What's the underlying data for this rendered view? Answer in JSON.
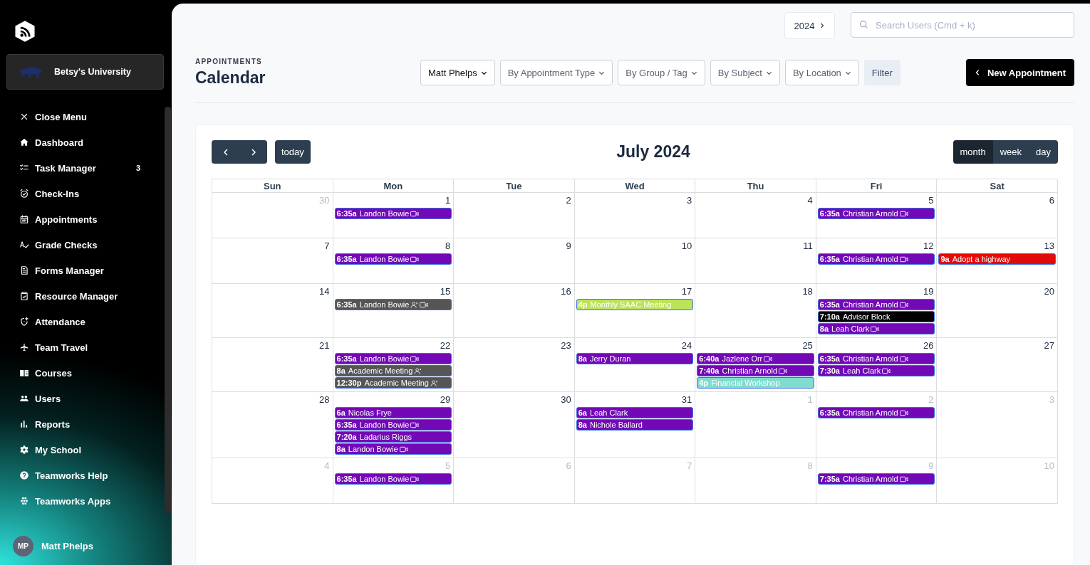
{
  "sidebar": {
    "university": "Betsy's University",
    "items": [
      {
        "label": "Close Menu"
      },
      {
        "label": "Dashboard"
      },
      {
        "label": "Task Manager",
        "badge": "3"
      },
      {
        "label": "Check-Ins"
      },
      {
        "label": "Appointments"
      },
      {
        "label": "Grade Checks"
      },
      {
        "label": "Forms Manager"
      },
      {
        "label": "Resource Manager"
      },
      {
        "label": "Attendance"
      },
      {
        "label": "Team Travel"
      },
      {
        "label": "Courses"
      },
      {
        "label": "Users"
      },
      {
        "label": "Reports"
      },
      {
        "label": "My School"
      },
      {
        "label": "Teamworks Help"
      },
      {
        "label": "Teamworks Apps"
      }
    ],
    "user": {
      "initials": "MP",
      "name": "Matt Phelps"
    }
  },
  "header": {
    "year": "2024",
    "search": {
      "placeholder": "Search Users (Cmd + k)"
    }
  },
  "page": {
    "eyebrow": "APPOINTMENTS",
    "title": "Calendar"
  },
  "filters": [
    {
      "label": "Matt Phelps",
      "set": true
    },
    {
      "label": "By Appointment Type",
      "set": false
    },
    {
      "label": "By Group / Tag",
      "set": false
    },
    {
      "label": "By Subject",
      "set": false
    },
    {
      "label": "By Location",
      "set": false
    }
  ],
  "filter_button": "Filter",
  "new_button": "New Appointment",
  "calendar": {
    "title": "July 2024",
    "today": "today",
    "views": [
      {
        "label": "month",
        "selected": true
      },
      {
        "label": "week",
        "selected": false
      },
      {
        "label": "day",
        "selected": false
      }
    ],
    "weekdays": [
      "Sun",
      "Mon",
      "Tue",
      "Wed",
      "Thu",
      "Fri",
      "Sat"
    ],
    "weeks": [
      {
        "days": [
          {
            "date": "30",
            "other_month": true
          },
          {
            "date": "1",
            "other_month": false,
            "events": [
              {
                "time": "6:35a",
                "title": "Landon Bowie",
                "color": "#7209b7",
                "invite": false,
                "video": true
              }
            ]
          },
          {
            "date": "2",
            "other_month": false
          },
          {
            "date": "3",
            "other_month": false
          },
          {
            "date": "4",
            "other_month": false
          },
          {
            "date": "5",
            "other_month": false,
            "events": [
              {
                "time": "6:35a",
                "title": "Christian Arnold",
                "color": "#7209b7",
                "invite": false,
                "video": true
              }
            ]
          },
          {
            "date": "6",
            "other_month": false
          }
        ]
      },
      {
        "days": [
          {
            "date": "7",
            "other_month": false
          },
          {
            "date": "8",
            "other_month": false,
            "events": [
              {
                "time": "6:35a",
                "title": "Landon Bowie",
                "color": "#7209b7",
                "invite": false,
                "video": true
              }
            ]
          },
          {
            "date": "9",
            "other_month": false
          },
          {
            "date": "10",
            "other_month": false
          },
          {
            "date": "11",
            "other_month": false
          },
          {
            "date": "12",
            "other_month": false,
            "events": [
              {
                "time": "6:35a",
                "title": "Christian Arnold",
                "color": "#7209b7",
                "invite": false,
                "video": true
              }
            ]
          },
          {
            "date": "13",
            "other_month": false,
            "events": [
              {
                "time": "9a",
                "title": "Adopt a highway",
                "color": "#e00b0b",
                "invite": false,
                "video": false
              }
            ]
          }
        ]
      },
      {
        "days": [
          {
            "date": "14",
            "other_month": false
          },
          {
            "date": "15",
            "other_month": false,
            "events": [
              {
                "time": "6:35a",
                "title": "Landon Bowie",
                "color": "#555555",
                "invite": true,
                "video": true
              }
            ]
          },
          {
            "date": "16",
            "other_month": false
          },
          {
            "date": "17",
            "other_month": false,
            "events": [
              {
                "time": "4p",
                "title": "Monthly SAAC Meeting",
                "color": "#bde35a",
                "invite": false,
                "video": false
              }
            ]
          },
          {
            "date": "18",
            "other_month": false
          },
          {
            "date": "19",
            "other_month": false,
            "events": [
              {
                "time": "6:35a",
                "title": "Christian Arnold",
                "color": "#7209b7",
                "invite": false,
                "video": true
              },
              {
                "time": "7:10a",
                "title": "Advisor Block",
                "color": "#000000",
                "invite": false,
                "video": false
              },
              {
                "time": "8a",
                "title": "Leah Clark",
                "color": "#7209b7",
                "invite": false,
                "video": true
              }
            ]
          },
          {
            "date": "20",
            "other_month": false
          }
        ]
      },
      {
        "days": [
          {
            "date": "21",
            "other_month": false
          },
          {
            "date": "22",
            "other_month": false,
            "events": [
              {
                "time": "6:35a",
                "title": "Landon Bowie",
                "color": "#7209b7",
                "invite": false,
                "video": true
              },
              {
                "time": "8a",
                "title": "Academic Meeting",
                "color": "#555555",
                "invite": true,
                "video": false
              },
              {
                "time": "12:30p",
                "title": "Academic Meeting",
                "color": "#555555",
                "invite": true,
                "video": false
              }
            ]
          },
          {
            "date": "23",
            "other_month": false
          },
          {
            "date": "24",
            "other_month": false,
            "events": [
              {
                "time": "8a",
                "title": "Jerry Duran",
                "color": "#7209b7",
                "invite": false,
                "video": false
              }
            ]
          },
          {
            "date": "25",
            "other_month": false,
            "events": [
              {
                "time": "6:40a",
                "title": "Jazlene Orr",
                "color": "#7209b7",
                "invite": false,
                "video": true
              },
              {
                "time": "7:40a",
                "title": "Christian Arnold",
                "color": "#7209b7",
                "invite": false,
                "video": true
              },
              {
                "time": "4p",
                "title": "Financial Workshop",
                "color": "#7fdccf",
                "invite": false,
                "video": false
              }
            ]
          },
          {
            "date": "26",
            "other_month": false,
            "events": [
              {
                "time": "6:35a",
                "title": "Christian Arnold",
                "color": "#7209b7",
                "invite": false,
                "video": true
              },
              {
                "time": "7:30a",
                "title": "Leah Clark",
                "color": "#7209b7",
                "invite": false,
                "video": true
              }
            ]
          },
          {
            "date": "27",
            "other_month": false
          }
        ]
      },
      {
        "days": [
          {
            "date": "28",
            "other_month": false
          },
          {
            "date": "29",
            "other_month": false,
            "events": [
              {
                "time": "6a",
                "title": "Nicolas Frye",
                "color": "#7209b7",
                "invite": false,
                "video": false
              },
              {
                "time": "6:35a",
                "title": "Landon Bowie",
                "color": "#7209b7",
                "invite": false,
                "video": true
              },
              {
                "time": "7:20a",
                "title": "Ladarius Riggs",
                "color": "#7209b7",
                "invite": false,
                "video": false
              },
              {
                "time": "8a",
                "title": "Landon Bowie",
                "color": "#7209b7",
                "invite": false,
                "video": true
              }
            ]
          },
          {
            "date": "30",
            "other_month": false
          },
          {
            "date": "31",
            "other_month": false,
            "events": [
              {
                "time": "6a",
                "title": "Leah Clark",
                "color": "#7209b7",
                "invite": false,
                "video": false
              },
              {
                "time": "8a",
                "title": "Nichole Ballard",
                "color": "#7209b7",
                "invite": false,
                "video": false
              }
            ]
          },
          {
            "date": "1",
            "other_month": true
          },
          {
            "date": "2",
            "other_month": true,
            "events": [
              {
                "time": "6:35a",
                "title": "Christian Arnold",
                "color": "#7209b7",
                "invite": false,
                "video": true
              }
            ]
          },
          {
            "date": "3",
            "other_month": true
          }
        ]
      },
      {
        "days": [
          {
            "date": "4",
            "other_month": true
          },
          {
            "date": "5",
            "other_month": true,
            "events": [
              {
                "time": "6:35a",
                "title": "Landon Bowie",
                "color": "#7209b7",
                "invite": false,
                "video": true
              }
            ]
          },
          {
            "date": "6",
            "other_month": true
          },
          {
            "date": "7",
            "other_month": true
          },
          {
            "date": "8",
            "other_month": true
          },
          {
            "date": "9",
            "other_month": true,
            "events": [
              {
                "time": "7:35a",
                "title": "Christian Arnold",
                "color": "#7209b7",
                "invite": false,
                "video": true
              }
            ]
          },
          {
            "date": "10",
            "other_month": true
          }
        ]
      }
    ]
  }
}
